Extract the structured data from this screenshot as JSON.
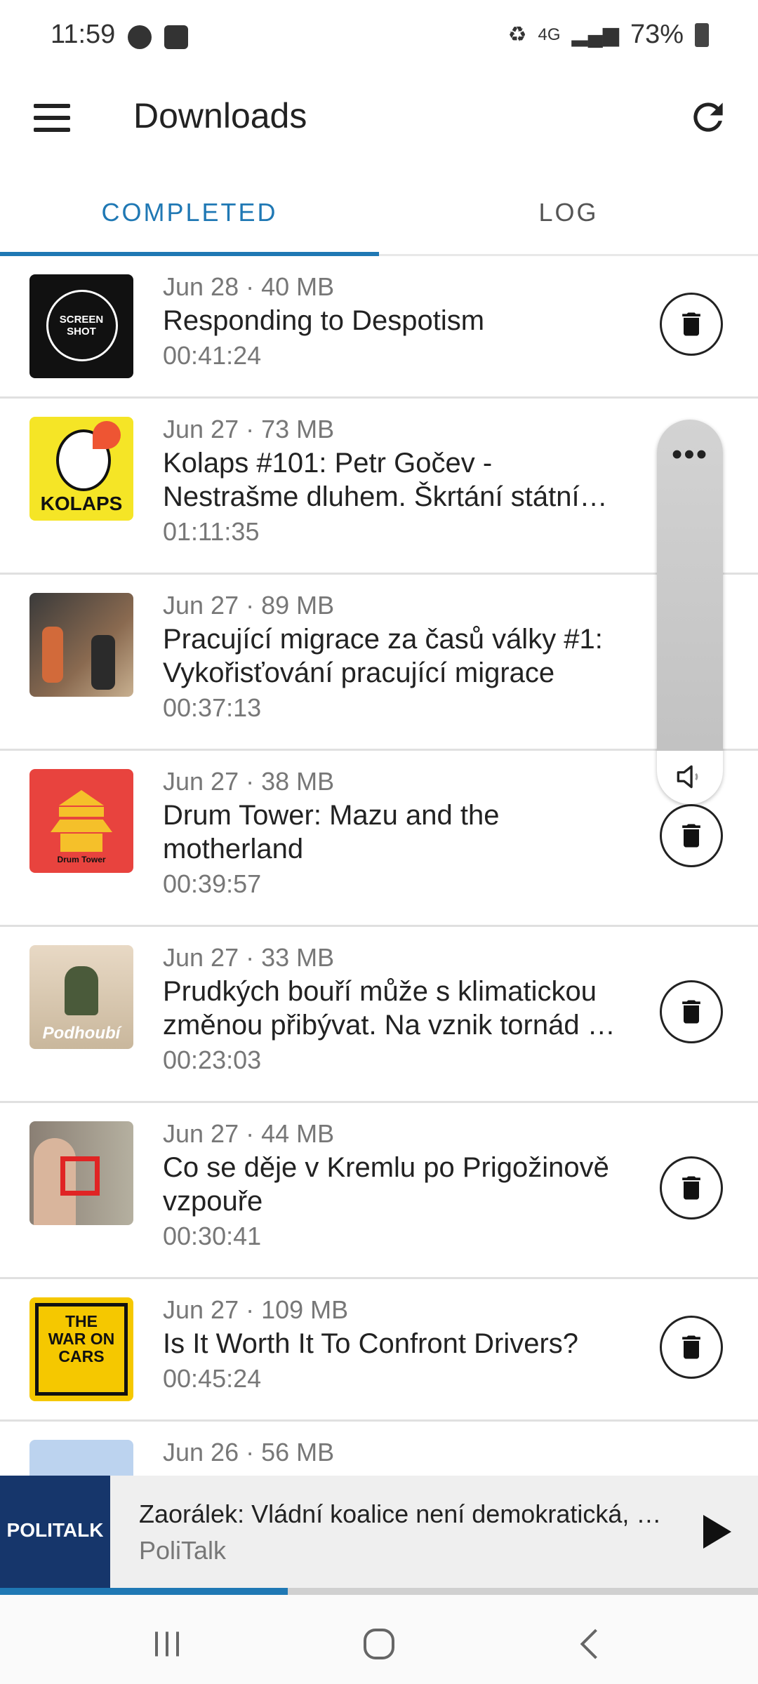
{
  "status": {
    "time": "11:59",
    "battery": "73%",
    "network": "4G",
    "icons_left": [
      "messenger-icon",
      "clock-icon"
    ]
  },
  "appbar": {
    "title": "Downloads"
  },
  "tabs": [
    {
      "label": "COMPLETED",
      "active": true
    },
    {
      "label": "LOG",
      "active": false
    }
  ],
  "colors": {
    "accent": "#1f78b4",
    "text": "#222222",
    "secondary": "#777777"
  },
  "items": [
    {
      "meta": "Jun 28 · 40 MB",
      "title": "Responding to Despotism",
      "duration": "00:41:24",
      "thumb_text": "SCREEN SHOT"
    },
    {
      "meta": "Jun 27 · 73 MB",
      "title_line1": "Kolaps #101: Petr Gočev -",
      "title_line2": "Nestrašme dluhem. Škrtání státní…",
      "duration": "01:11:35",
      "thumb_text": "KOLAPS"
    },
    {
      "meta": "Jun 27 · 89 MB",
      "title_line1": "Pracující migrace za časů války #1:",
      "title_line2": "Vykořisťování pracující migrace",
      "duration": "00:37:13"
    },
    {
      "meta": "Jun 27 · 38 MB",
      "title_line1": "Drum Tower: Mazu and the",
      "title_line2": "motherland",
      "duration": "00:39:57",
      "thumb_text": "Drum Tower"
    },
    {
      "meta": "Jun 27 · 33 MB",
      "title_line1": "Prudkých bouří může s klimatickou",
      "title_line2": "změnou přibývat. Na vznik tornád …",
      "duration": "00:23:03",
      "thumb_text": "Podhoubí"
    },
    {
      "meta": "Jun 27 · 44 MB",
      "title_line1": "Co se děje v Kremlu po Prigožinově",
      "title_line2": "vzpouře",
      "duration": "00:30:41"
    },
    {
      "meta": "Jun 27 · 109 MB",
      "title": "Is It Worth It To Confront Drivers?",
      "duration": "00:45:24",
      "thumb_text": "THE WAR ON CARS"
    },
    {
      "meta": "Jun 26 · 56 MB"
    }
  ],
  "volume_panel": {
    "more_label": "•••"
  },
  "player": {
    "title": "Zaorálek: Vládní koalice není demokratická, …",
    "podcast": "PoliTalk",
    "art_text": "POLITALK",
    "progress": 0.38
  }
}
